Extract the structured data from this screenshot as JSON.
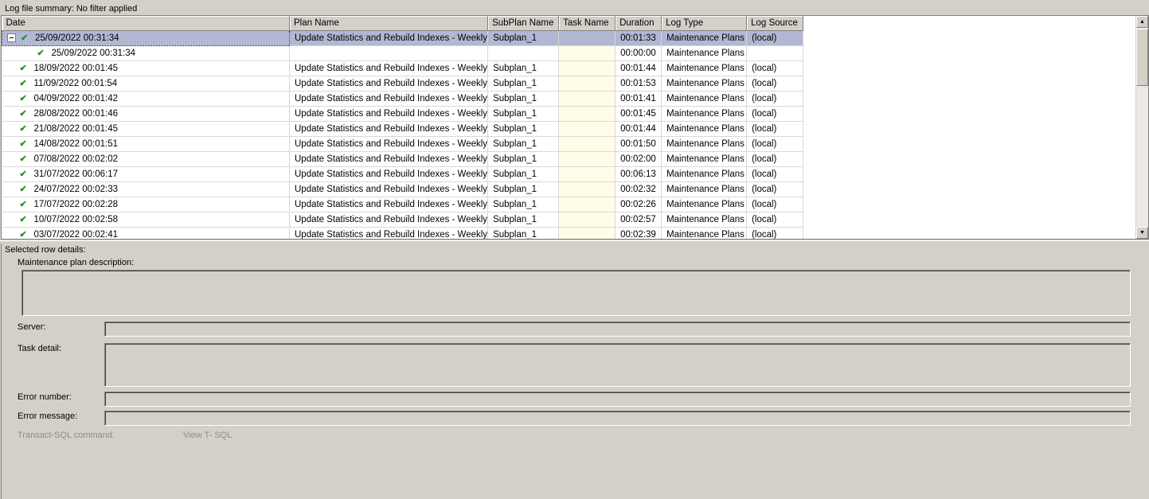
{
  "summary": "Log file summary: No filter applied",
  "columns": [
    "Date",
    "Plan Name",
    "SubPlan Name",
    "Task Name",
    "Duration",
    "Log Type",
    "Log Source"
  ],
  "rows": [
    {
      "date": "25/09/2022 00:31:34",
      "plan": "Update Statistics and Rebuild Indexes - Weekly",
      "subplan": "Subplan_1",
      "task": "",
      "duration": "00:01:33",
      "logtype": "Maintenance Plans",
      "source": "(local)",
      "level": 0,
      "expanded": true,
      "selected": true
    },
    {
      "date": "25/09/2022 00:31:34",
      "plan": "",
      "subplan": "",
      "task": "",
      "duration": "00:00:00",
      "logtype": "Maintenance Plans",
      "source": "",
      "level": 2,
      "expanded": false,
      "selected": false
    },
    {
      "date": "18/09/2022 00:01:45",
      "plan": "Update Statistics and Rebuild Indexes - Weekly",
      "subplan": "Subplan_1",
      "task": "",
      "duration": "00:01:44",
      "logtype": "Maintenance Plans",
      "source": "(local)",
      "level": 1,
      "expanded": false,
      "selected": false
    },
    {
      "date": "11/09/2022 00:01:54",
      "plan": "Update Statistics and Rebuild Indexes - Weekly",
      "subplan": "Subplan_1",
      "task": "",
      "duration": "00:01:53",
      "logtype": "Maintenance Plans",
      "source": "(local)",
      "level": 1,
      "expanded": false,
      "selected": false
    },
    {
      "date": "04/09/2022 00:01:42",
      "plan": "Update Statistics and Rebuild Indexes - Weekly",
      "subplan": "Subplan_1",
      "task": "",
      "duration": "00:01:41",
      "logtype": "Maintenance Plans",
      "source": "(local)",
      "level": 1,
      "expanded": false,
      "selected": false
    },
    {
      "date": "28/08/2022 00:01:46",
      "plan": "Update Statistics and Rebuild Indexes - Weekly",
      "subplan": "Subplan_1",
      "task": "",
      "duration": "00:01:45",
      "logtype": "Maintenance Plans",
      "source": "(local)",
      "level": 1,
      "expanded": false,
      "selected": false
    },
    {
      "date": "21/08/2022 00:01:45",
      "plan": "Update Statistics and Rebuild Indexes - Weekly",
      "subplan": "Subplan_1",
      "task": "",
      "duration": "00:01:44",
      "logtype": "Maintenance Plans",
      "source": "(local)",
      "level": 1,
      "expanded": false,
      "selected": false
    },
    {
      "date": "14/08/2022 00:01:51",
      "plan": "Update Statistics and Rebuild Indexes - Weekly",
      "subplan": "Subplan_1",
      "task": "",
      "duration": "00:01:50",
      "logtype": "Maintenance Plans",
      "source": "(local)",
      "level": 1,
      "expanded": false,
      "selected": false
    },
    {
      "date": "07/08/2022 00:02:02",
      "plan": "Update Statistics and Rebuild Indexes - Weekly",
      "subplan": "Subplan_1",
      "task": "",
      "duration": "00:02:00",
      "logtype": "Maintenance Plans",
      "source": "(local)",
      "level": 1,
      "expanded": false,
      "selected": false
    },
    {
      "date": "31/07/2022 00:06:17",
      "plan": "Update Statistics and Rebuild Indexes - Weekly",
      "subplan": "Subplan_1",
      "task": "",
      "duration": "00:06:13",
      "logtype": "Maintenance Plans",
      "source": "(local)",
      "level": 1,
      "expanded": false,
      "selected": false
    },
    {
      "date": "24/07/2022 00:02:33",
      "plan": "Update Statistics and Rebuild Indexes - Weekly",
      "subplan": "Subplan_1",
      "task": "",
      "duration": "00:02:32",
      "logtype": "Maintenance Plans",
      "source": "(local)",
      "level": 1,
      "expanded": false,
      "selected": false
    },
    {
      "date": "17/07/2022 00:02:28",
      "plan": "Update Statistics and Rebuild Indexes - Weekly",
      "subplan": "Subplan_1",
      "task": "",
      "duration": "00:02:26",
      "logtype": "Maintenance Plans",
      "source": "(local)",
      "level": 1,
      "expanded": false,
      "selected": false
    },
    {
      "date": "10/07/2022 00:02:58",
      "plan": "Update Statistics and Rebuild Indexes - Weekly",
      "subplan": "Subplan_1",
      "task": "",
      "duration": "00:02:57",
      "logtype": "Maintenance Plans",
      "source": "(local)",
      "level": 1,
      "expanded": false,
      "selected": false
    },
    {
      "date": "03/07/2022 00:02:41",
      "plan": "Update Statistics and Rebuild Indexes - Weekly",
      "subplan": "Subplan_1",
      "task": "",
      "duration": "00:02:39",
      "logtype": "Maintenance Plans",
      "source": "(local)",
      "level": 1,
      "expanded": false,
      "selected": false
    }
  ],
  "details": {
    "heading": "Selected row details:",
    "description_label": "Maintenance plan description:",
    "server_label": "Server:",
    "task_detail_label": "Task detail:",
    "error_number_label": "Error number:",
    "error_message_label": "Error message:",
    "tsql_label": "Transact-SQL command:",
    "view_tsql": "View T- SQL"
  },
  "icons": {
    "status": "check-icon",
    "collapse": "tree-collapse-icon",
    "scroll_up": "scroll-up-icon",
    "scroll_down": "scroll-down-icon"
  },
  "colors": {
    "selected_row": "#b2b7d4",
    "task_column": "#fffde8",
    "check": "#2e8a2e",
    "chrome": "#d4d0c8"
  }
}
